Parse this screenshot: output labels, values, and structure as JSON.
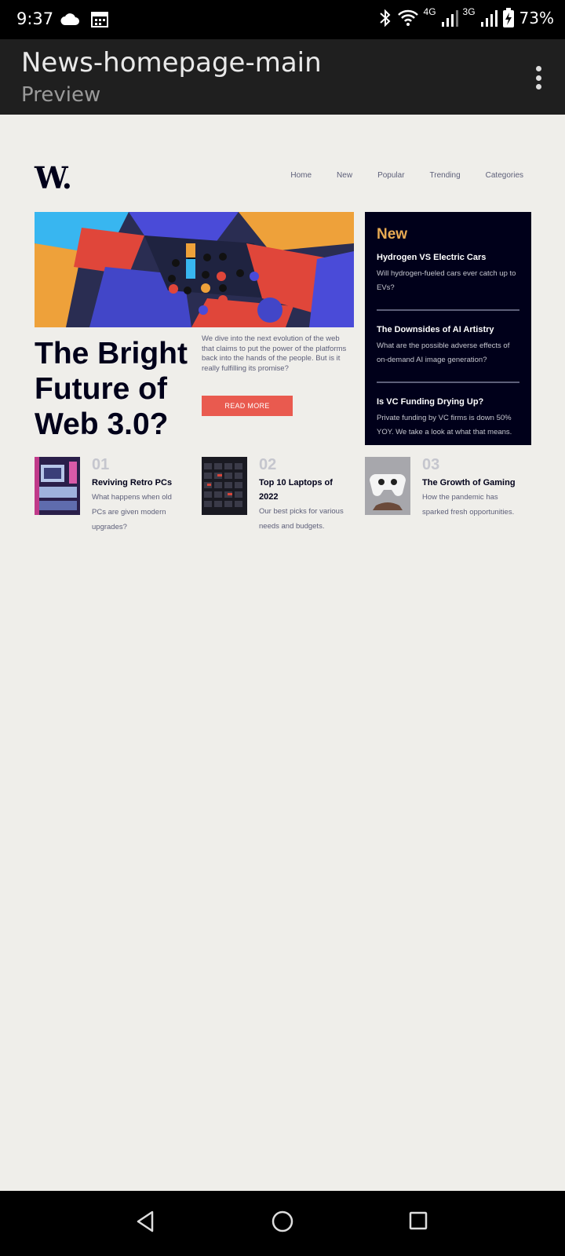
{
  "status": {
    "time": "9:37",
    "battery": "73%",
    "net1": "4G",
    "net2": "3G"
  },
  "appbar": {
    "title": "News-homepage-main",
    "subtitle": "Preview"
  },
  "site": {
    "logo": "W",
    "nav": [
      "Home",
      "New",
      "Popular",
      "Trending",
      "Categories"
    ],
    "hero": {
      "title": "The Bright Future of Web 3.0?",
      "description": "We dive into the next evolution of the web that claims to put the power of the platforms back into the hands of the people. But is it really fulfilling its promise?",
      "button": "READ MORE"
    },
    "new_panel": {
      "heading": "New",
      "items": [
        {
          "title": "Hydrogen VS Electric Cars",
          "text": "Will hydrogen-fueled cars ever catch up to EVs?"
        },
        {
          "title": "The Downsides of AI Artistry",
          "text": "What are the possible adverse effects of on-demand AI image generation?"
        },
        {
          "title": "Is VC Funding Drying Up?",
          "text": "Private funding by VC firms is down 50% YOY. We take a look at what that means."
        }
      ]
    },
    "cards": [
      {
        "num": "01",
        "title": "Reviving Retro PCs",
        "text": "What happens when old PCs are given modern upgrades?"
      },
      {
        "num": "02",
        "title": "Top 10 Laptops of 2022",
        "text": "Our best picks for various needs and budgets."
      },
      {
        "num": "03",
        "title": "The Growth of Gaming",
        "text": "How the pandemic has sparked fresh opportunities."
      }
    ]
  },
  "colors": {
    "accent_red": "#e95a4f",
    "accent_orange": "#e9ab53",
    "dark_navy": "#00001a",
    "grayish_blue": "#5d5f79",
    "off_white": "#efeeea"
  }
}
